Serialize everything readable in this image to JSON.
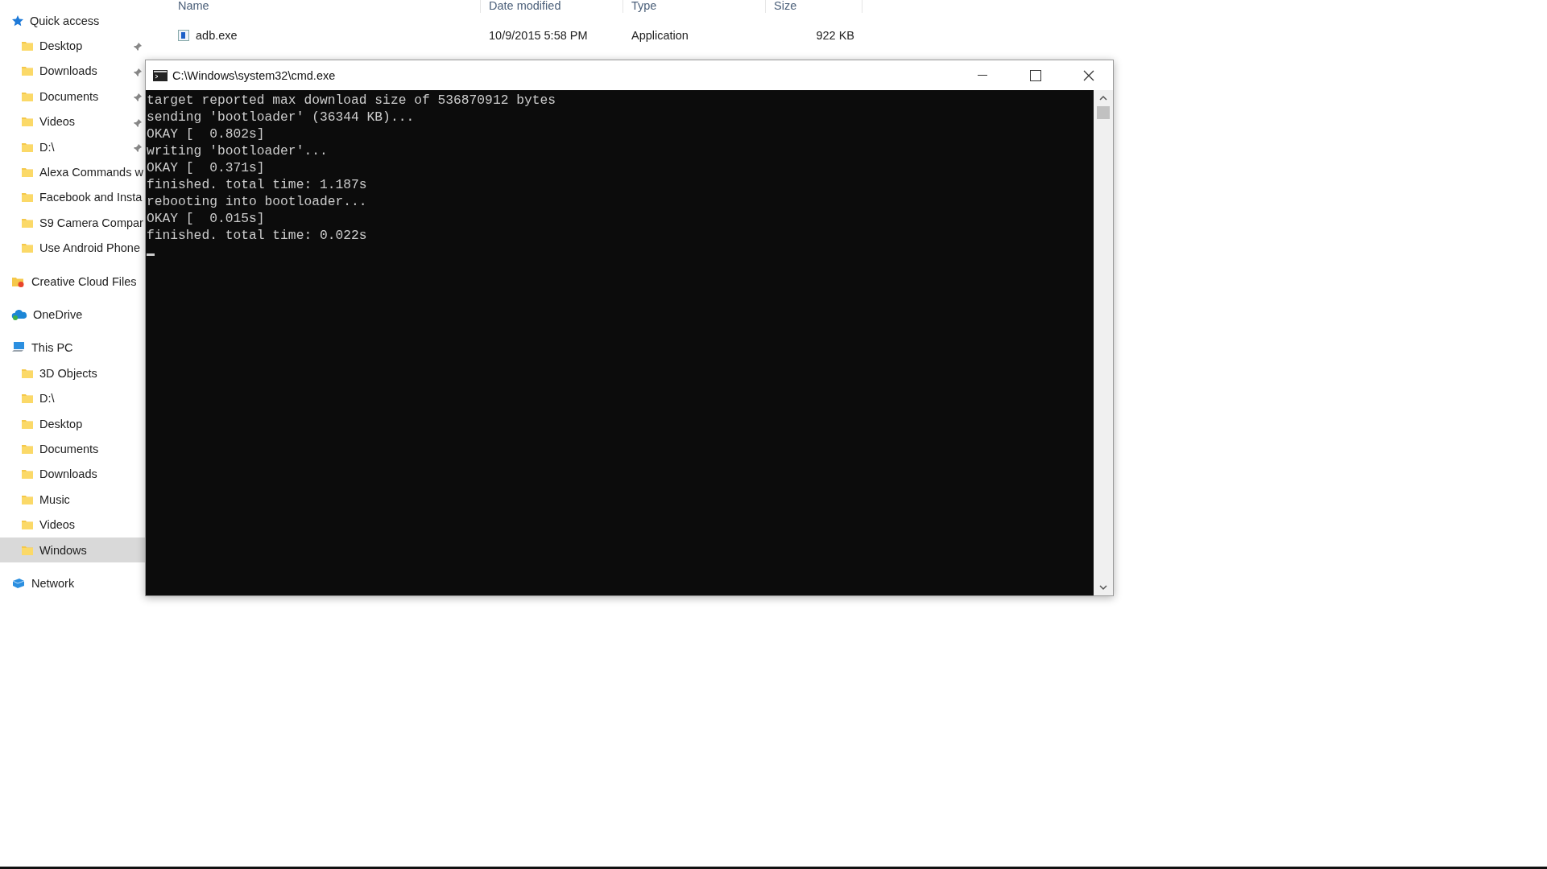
{
  "sidebar": {
    "sections": [
      {
        "label": "Quick access",
        "selected": false,
        "children": [
          {
            "label": "Desktop",
            "pinned": true,
            "selected": false
          },
          {
            "label": "Downloads",
            "pinned": true,
            "selected": false
          },
          {
            "label": "Documents",
            "pinned": true,
            "selected": false
          },
          {
            "label": "Videos",
            "pinned": true,
            "selected": false
          },
          {
            "label": "D:\\",
            "pinned": true,
            "selected": false
          },
          {
            "label": "Alexa Commands w",
            "pinned": false,
            "selected": false
          },
          {
            "label": "Facebook and Insta",
            "pinned": false,
            "selected": false
          },
          {
            "label": "S9 Camera Compar",
            "pinned": false,
            "selected": false
          },
          {
            "label": "Use Android Phone",
            "pinned": false,
            "selected": false
          }
        ]
      },
      {
        "label": "Creative Cloud Files",
        "selected": false
      },
      {
        "label": "OneDrive",
        "selected": false
      },
      {
        "label": "This PC",
        "selected": false,
        "children": [
          {
            "label": "3D Objects",
            "pinned": false,
            "selected": false
          },
          {
            "label": "D:\\",
            "pinned": false,
            "selected": false
          },
          {
            "label": "Desktop",
            "pinned": false,
            "selected": false
          },
          {
            "label": "Documents",
            "pinned": false,
            "selected": false
          },
          {
            "label": "Downloads",
            "pinned": false,
            "selected": false
          },
          {
            "label": "Music",
            "pinned": false,
            "selected": false
          },
          {
            "label": "Videos",
            "pinned": false,
            "selected": false
          },
          {
            "label": "Windows",
            "pinned": false,
            "selected": true
          }
        ]
      },
      {
        "label": "Network",
        "selected": false
      }
    ]
  },
  "file_list": {
    "columns": [
      "Name",
      "Date modified",
      "Type",
      "Size"
    ],
    "rows": [
      {
        "cells": [
          "adb.exe",
          "10/9/2015 5:58 PM",
          "Application",
          "922 KB"
        ]
      }
    ]
  },
  "console_window": {
    "title": "C:\\Windows\\system32\\cmd.exe",
    "lines": [
      "target reported max download size of 536870912 bytes",
      "sending 'bootloader' (36344 KB)...",
      "OKAY [  0.802s]",
      "writing 'bootloader'...",
      "OKAY [  0.371s]",
      "finished. total time: 1.187s",
      "rebooting into bootloader...",
      "OKAY [  0.015s]",
      "finished. total time: 0.022s"
    ]
  }
}
